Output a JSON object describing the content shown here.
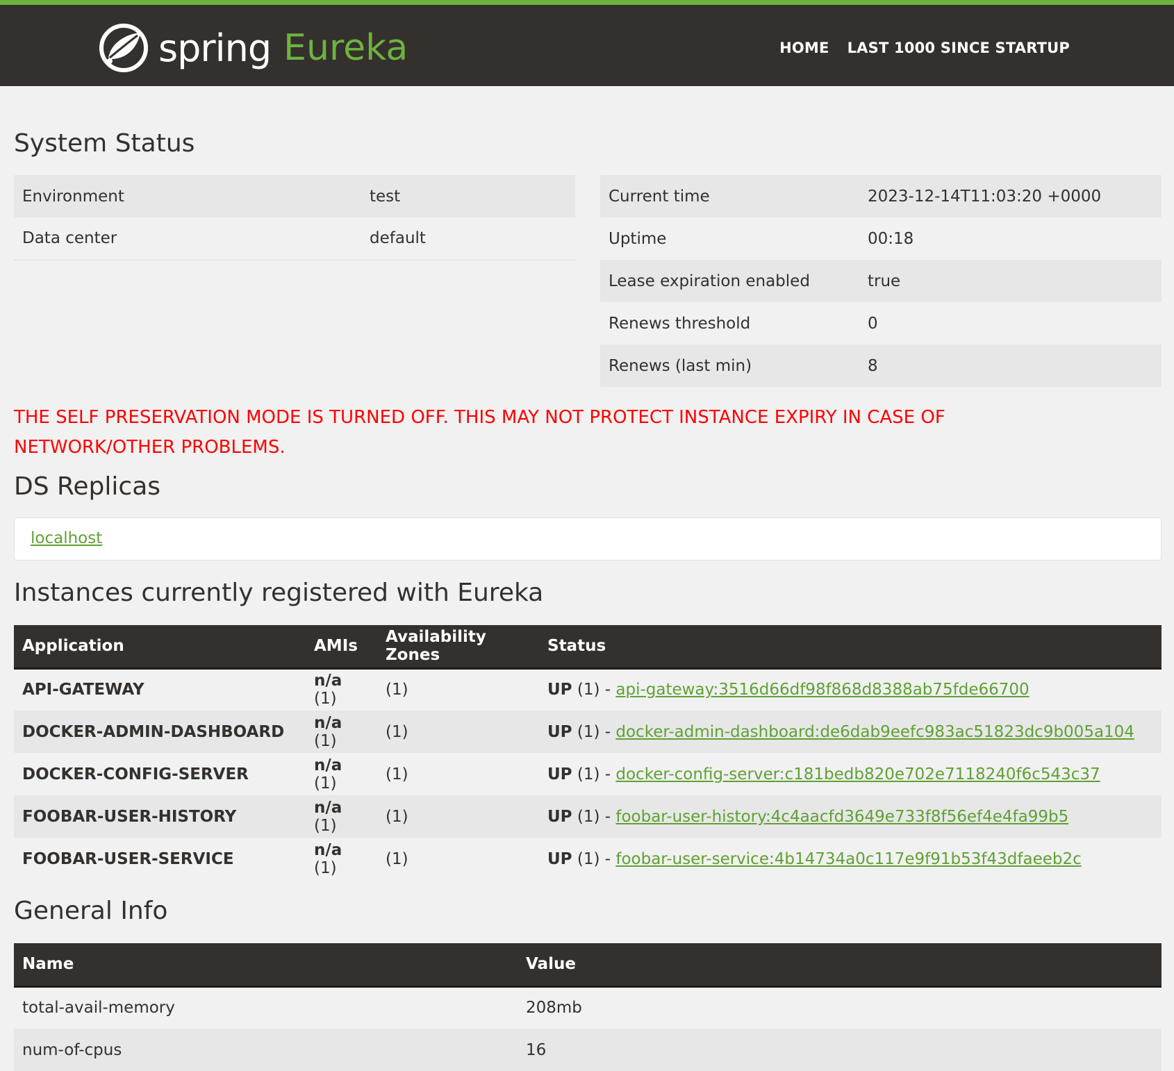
{
  "header": {
    "brand_spring": "spring",
    "brand_eureka": "Eureka",
    "nav": [
      {
        "label": "HOME"
      },
      {
        "label": "LAST 1000 SINCE STARTUP"
      }
    ]
  },
  "system_status": {
    "title": "System Status",
    "left": [
      {
        "label": "Environment",
        "value": "test"
      },
      {
        "label": "Data center",
        "value": "default"
      }
    ],
    "right": [
      {
        "label": "Current time",
        "value": "2023-12-14T11:03:20 +0000"
      },
      {
        "label": "Uptime",
        "value": "00:18"
      },
      {
        "label": "Lease expiration enabled",
        "value": "true"
      },
      {
        "label": "Renews threshold",
        "value": "0"
      },
      {
        "label": "Renews (last min)",
        "value": "8"
      }
    ]
  },
  "warning": {
    "line1": "THE SELF PRESERVATION MODE IS TURNED OFF. THIS MAY NOT PROTECT INSTANCE EXPIRY IN CASE OF",
    "line2": "NETWORK/OTHER PROBLEMS."
  },
  "ds_replicas": {
    "title": "DS Replicas",
    "link": "localhost"
  },
  "instances": {
    "title": "Instances currently registered with Eureka",
    "headers": [
      "Application",
      "AMIs",
      "Availability Zones",
      "Status"
    ],
    "rows": [
      {
        "app": "API-GATEWAY",
        "amis_bold": "n/a",
        "amis_count": "(1)",
        "zones": "(1)",
        "status_bold": "UP",
        "status_rest": "(1) -",
        "instance": "api-gateway:3516d66df98f868d8388ab75fde66700"
      },
      {
        "app": "DOCKER-ADMIN-DASHBOARD",
        "amis_bold": "n/a",
        "amis_count": "(1)",
        "zones": "(1)",
        "status_bold": "UP",
        "status_rest": "(1) -",
        "instance": "docker-admin-dashboard:de6dab9eefc983ac51823dc9b005a104"
      },
      {
        "app": "DOCKER-CONFIG-SERVER",
        "amis_bold": "n/a",
        "amis_count": "(1)",
        "zones": "(1)",
        "status_bold": "UP",
        "status_rest": "(1) -",
        "instance": "docker-config-server:c181bedb820e702e7118240f6c543c37"
      },
      {
        "app": "FOOBAR-USER-HISTORY",
        "amis_bold": "n/a",
        "amis_count": "(1)",
        "zones": "(1)",
        "status_bold": "UP",
        "status_rest": "(1) -",
        "instance": "foobar-user-history:4c4aacfd3649e733f8f56ef4e4fa99b5"
      },
      {
        "app": "FOOBAR-USER-SERVICE",
        "amis_bold": "n/a",
        "amis_count": "(1)",
        "zones": "(1)",
        "status_bold": "UP",
        "status_rest": "(1) -",
        "instance": "foobar-user-service:4b14734a0c117e9f91b53f43dfaeeb2c"
      }
    ]
  },
  "general_info": {
    "title": "General Info",
    "headers": [
      "Name",
      "Value"
    ],
    "rows": [
      {
        "name": "total-avail-memory",
        "value": "208mb"
      },
      {
        "name": "num-of-cpus",
        "value": "16"
      }
    ]
  },
  "colors": {
    "accent_green": "#6db33f",
    "header_dark": "#34302d",
    "warning_red": "#ff0000"
  }
}
